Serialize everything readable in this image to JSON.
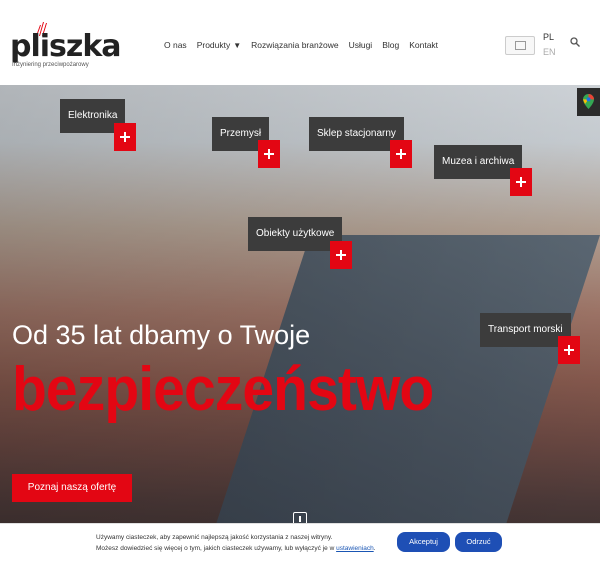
{
  "logo": {
    "text": "pliszka",
    "subtitle": "Inżyniering przeciwpożarowy"
  },
  "nav": {
    "items": [
      "O nas",
      "Produkty",
      "Rozwiązania branżowe",
      "Usługi",
      "Blog",
      "Kontakt"
    ]
  },
  "lang": {
    "pl": "PL",
    "en": "EN"
  },
  "hero": {
    "tags": [
      "Elektronika",
      "Przemysł",
      "Sklep stacjonarny",
      "Muzea i archiwa",
      "Obiekty użytkowe",
      "Transport morski"
    ],
    "headline": "Od 35 lat dbamy o Twoje",
    "headline_big": "bezpieczeństwo",
    "offer_button": "Poznaj naszą ofertę"
  },
  "cookie": {
    "line1": "Używamy ciasteczek, aby zapewnić najlepszą jakość korzystania z naszej witryny.",
    "line2_prefix": "Możesz dowiedzieć się więcej o tym, jakich ciasteczek używamy, lub wyłączyć je w ",
    "line2_link": "ustawieniach",
    "line2_suffix": ".",
    "accept": "Akceptuj",
    "reject": "Odrzuć"
  },
  "colors": {
    "brand_red": "#e30613",
    "tag_bg": "#3c3c3c",
    "cookie_button": "#1e4fb5"
  },
  "icons": {
    "search": "search-icon",
    "maps": "map-pin-icon",
    "caret": "chevron-down-icon"
  }
}
